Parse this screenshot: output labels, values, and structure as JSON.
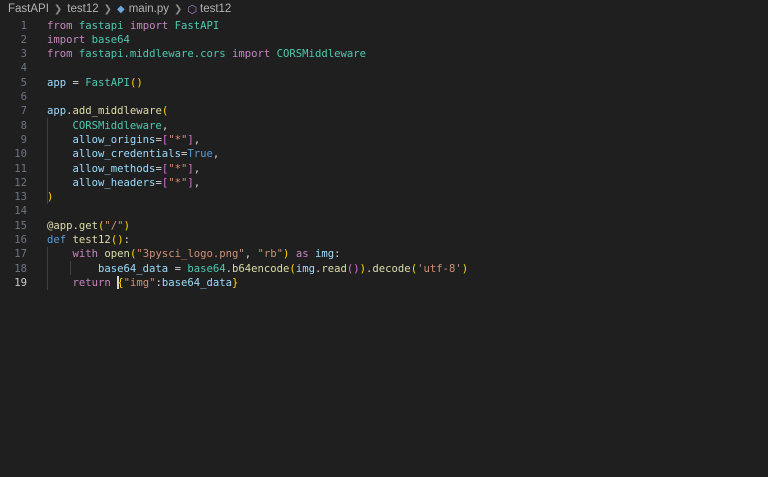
{
  "breadcrumb": {
    "root": "FastAPI",
    "folder": "test12",
    "file": "main.py",
    "symbol": "test12",
    "file_icon": "python-file-icon",
    "symbol_icon": "function-cube-icon"
  },
  "editor": {
    "active_line": 19,
    "lines": [
      {
        "n": "1",
        "t": [
          [
            "kw",
            "from"
          ],
          [
            "op",
            " "
          ],
          [
            "cls",
            "fastapi"
          ],
          [
            "op",
            " "
          ],
          [
            "kw",
            "import"
          ],
          [
            "op",
            " "
          ],
          [
            "cls",
            "FastAPI"
          ]
        ]
      },
      {
        "n": "2",
        "t": [
          [
            "kw",
            "import"
          ],
          [
            "op",
            " "
          ],
          [
            "cls",
            "base64"
          ]
        ]
      },
      {
        "n": "3",
        "t": [
          [
            "kw",
            "from"
          ],
          [
            "op",
            " "
          ],
          [
            "cls",
            "fastapi.middleware.cors"
          ],
          [
            "op",
            " "
          ],
          [
            "kw",
            "import"
          ],
          [
            "op",
            " "
          ],
          [
            "cls",
            "CORSMiddleware"
          ]
        ]
      },
      {
        "n": "4",
        "t": []
      },
      {
        "n": "5",
        "t": [
          [
            "var",
            "app"
          ],
          [
            "op",
            " = "
          ],
          [
            "cls",
            "FastAPI"
          ],
          [
            "br1",
            "()"
          ]
        ]
      },
      {
        "n": "6",
        "t": []
      },
      {
        "n": "7",
        "t": [
          [
            "var",
            "app"
          ],
          [
            "op",
            "."
          ],
          [
            "fn",
            "add_middleware"
          ],
          [
            "br1",
            "("
          ]
        ]
      },
      {
        "n": "8",
        "t": [
          [
            "op",
            "    "
          ],
          [
            "cls",
            "CORSMiddleware"
          ],
          [
            "op",
            ","
          ]
        ]
      },
      {
        "n": "9",
        "t": [
          [
            "op",
            "    "
          ],
          [
            "var",
            "allow_origins"
          ],
          [
            "op",
            "="
          ],
          [
            "br2",
            "["
          ],
          [
            "str",
            "\"*\""
          ],
          [
            "br2",
            "]"
          ],
          [
            "op",
            ","
          ]
        ]
      },
      {
        "n": "10",
        "t": [
          [
            "op",
            "    "
          ],
          [
            "var",
            "allow_credentials"
          ],
          [
            "op",
            "="
          ],
          [
            "kwb",
            "True"
          ],
          [
            "op",
            ","
          ]
        ]
      },
      {
        "n": "11",
        "t": [
          [
            "op",
            "    "
          ],
          [
            "var",
            "allow_methods"
          ],
          [
            "op",
            "="
          ],
          [
            "br2",
            "["
          ],
          [
            "str",
            "\"*\""
          ],
          [
            "br2",
            "]"
          ],
          [
            "op",
            ","
          ]
        ]
      },
      {
        "n": "12",
        "t": [
          [
            "op",
            "    "
          ],
          [
            "var",
            "allow_headers"
          ],
          [
            "op",
            "="
          ],
          [
            "br2",
            "["
          ],
          [
            "str",
            "\"*\""
          ],
          [
            "br2",
            "]"
          ],
          [
            "op",
            ","
          ]
        ]
      },
      {
        "n": "13",
        "t": [
          [
            "br1",
            ")"
          ]
        ]
      },
      {
        "n": "14",
        "t": []
      },
      {
        "n": "15",
        "t": [
          [
            "fn",
            "@app.get"
          ],
          [
            "br1",
            "("
          ],
          [
            "str",
            "\"/\""
          ],
          [
            "br1",
            ")"
          ]
        ]
      },
      {
        "n": "16",
        "t": [
          [
            "kwb",
            "def"
          ],
          [
            "op",
            " "
          ],
          [
            "fn",
            "test12"
          ],
          [
            "br1",
            "()"
          ],
          [
            "op",
            ":"
          ]
        ]
      },
      {
        "n": "17",
        "t": [
          [
            "op",
            "    "
          ],
          [
            "kw",
            "with"
          ],
          [
            "op",
            " "
          ],
          [
            "fn",
            "open"
          ],
          [
            "br1",
            "("
          ],
          [
            "str",
            "\"3pysci_logo.png\""
          ],
          [
            "op",
            ", "
          ],
          [
            "str",
            "\"rb\""
          ],
          [
            "br1",
            ")"
          ],
          [
            "op",
            " "
          ],
          [
            "kw",
            "as"
          ],
          [
            "op",
            " "
          ],
          [
            "var",
            "img"
          ],
          [
            "op",
            ":"
          ]
        ]
      },
      {
        "n": "18",
        "t": [
          [
            "op",
            "        "
          ],
          [
            "var",
            "base64_data"
          ],
          [
            "op",
            " = "
          ],
          [
            "cls",
            "base64"
          ],
          [
            "op",
            "."
          ],
          [
            "fn",
            "b64encode"
          ],
          [
            "br1",
            "("
          ],
          [
            "var",
            "img"
          ],
          [
            "op",
            "."
          ],
          [
            "fn",
            "read"
          ],
          [
            "br2",
            "()"
          ],
          [
            "br1",
            ")"
          ],
          [
            "op",
            "."
          ],
          [
            "fn",
            "decode"
          ],
          [
            "br1",
            "("
          ],
          [
            "str",
            "'utf-8'"
          ],
          [
            "br1",
            ")"
          ]
        ]
      },
      {
        "n": "19",
        "t": [
          [
            "op",
            "    "
          ],
          [
            "kw",
            "return"
          ],
          [
            "op",
            " "
          ],
          [
            "cursor",
            ""
          ],
          [
            "br1",
            "{"
          ],
          [
            "str",
            "\"img\""
          ],
          [
            "op",
            ":"
          ],
          [
            "var",
            "base64_data"
          ],
          [
            "br1",
            "}"
          ]
        ]
      }
    ]
  }
}
